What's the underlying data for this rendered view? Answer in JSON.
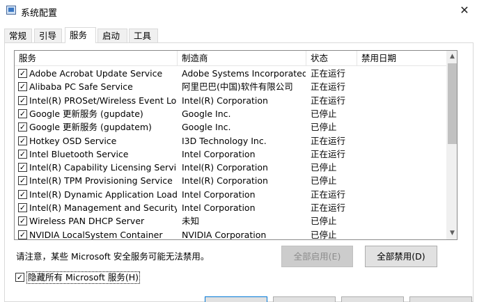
{
  "window": {
    "title": "系统配置",
    "close_glyph": "✕"
  },
  "tabs": [
    {
      "label": "常规"
    },
    {
      "label": "引导"
    },
    {
      "label": "服务"
    },
    {
      "label": "启动"
    },
    {
      "label": "工具"
    }
  ],
  "active_tab": "服务",
  "table": {
    "headers": {
      "service": "服务",
      "manufacturer": "制造商",
      "status": "状态",
      "disabled_date": "禁用日期"
    },
    "rows": [
      {
        "checked": true,
        "service": "Adobe Acrobat Update Service",
        "manufacturer": "Adobe Systems Incorporated",
        "status": "正在运行",
        "disabled_date": ""
      },
      {
        "checked": true,
        "service": "Alibaba PC Safe Service",
        "manufacturer": "阿里巴巴(中国)软件有限公司",
        "status": "正在运行",
        "disabled_date": ""
      },
      {
        "checked": true,
        "service": "Intel(R) PROSet/Wireless Event Log",
        "manufacturer": "Intel(R) Corporation",
        "status": "正在运行",
        "disabled_date": ""
      },
      {
        "checked": true,
        "service": "Google 更新服务 (gupdate)",
        "manufacturer": "Google Inc.",
        "status": "已停止",
        "disabled_date": ""
      },
      {
        "checked": true,
        "service": "Google 更新服务 (gupdatem)",
        "manufacturer": "Google Inc.",
        "status": "已停止",
        "disabled_date": ""
      },
      {
        "checked": true,
        "service": "Hotkey OSD Service",
        "manufacturer": "I3D Technology Inc.",
        "status": "正在运行",
        "disabled_date": ""
      },
      {
        "checked": true,
        "service": "Intel Bluetooth Service",
        "manufacturer": "Intel Corporation",
        "status": "正在运行",
        "disabled_date": ""
      },
      {
        "checked": true,
        "service": "Intel(R) Capability Licensing Servic...",
        "manufacturer": "Intel(R) Corporation",
        "status": "已停止",
        "disabled_date": ""
      },
      {
        "checked": true,
        "service": "Intel(R) TPM Provisioning Service",
        "manufacturer": "Intel(R) Corporation",
        "status": "已停止",
        "disabled_date": ""
      },
      {
        "checked": true,
        "service": "Intel(R) Dynamic Application Load...",
        "manufacturer": "Intel Corporation",
        "status": "正在运行",
        "disabled_date": ""
      },
      {
        "checked": true,
        "service": "Intel(R) Management and Security ...",
        "manufacturer": "Intel Corporation",
        "status": "正在运行",
        "disabled_date": ""
      },
      {
        "checked": true,
        "service": "Wireless PAN DHCP Server",
        "manufacturer": "未知",
        "status": "已停止",
        "disabled_date": ""
      },
      {
        "checked": true,
        "service": "NVIDIA LocalSystem Container",
        "manufacturer": "NVIDIA Corporation",
        "status": "已停止",
        "disabled_date": ""
      }
    ]
  },
  "note": "请注意，某些 Microsoft 安全服务可能无法禁用。",
  "buttons": {
    "enable_all": "全部启用(E)",
    "disable_all": "全部禁用(D)"
  },
  "hide_ms": {
    "label": "隐藏所有 Microsoft 服务(H)",
    "checked": true
  },
  "icons": {
    "checkbox": "checkbox-icon",
    "scroll_up": "chevron-up-icon",
    "scroll_down": "chevron-down-icon",
    "close": "close-icon",
    "app": "msconfig-app-icon"
  }
}
